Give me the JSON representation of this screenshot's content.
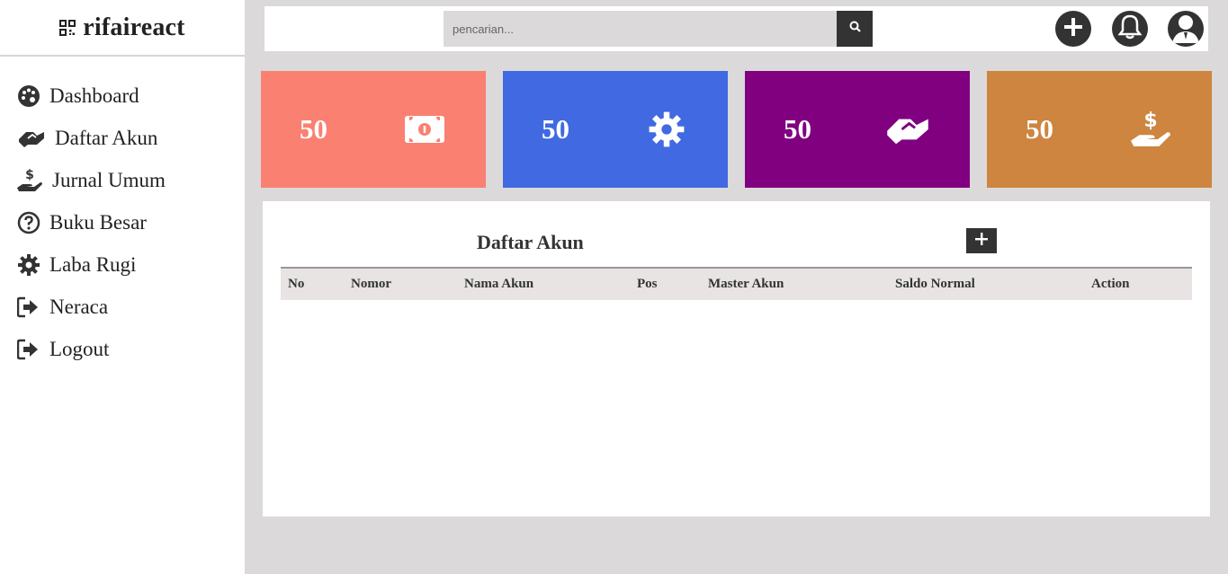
{
  "brand": {
    "name": "rifaireact",
    "icon": "qrcode-icon"
  },
  "sidebar": {
    "items": [
      {
        "label": "Dashboard",
        "icon": "palette-icon"
      },
      {
        "label": "Daftar Akun",
        "icon": "handshake-icon"
      },
      {
        "label": "Jurnal Umum",
        "icon": "hand-holding-dollar-icon"
      },
      {
        "label": "Buku Besar",
        "icon": "question-circle-icon"
      },
      {
        "label": "Laba Rugi",
        "icon": "gear-icon"
      },
      {
        "label": "Neraca",
        "icon": "sign-out-icon"
      },
      {
        "label": "Logout",
        "icon": "sign-out-icon"
      }
    ]
  },
  "topbar": {
    "search_placeholder": "pencarian...",
    "icons": [
      "search-icon",
      "plus-circle-icon",
      "bell-icon",
      "user-icon"
    ]
  },
  "cards": [
    {
      "value": "50",
      "icon": "money-bill-icon",
      "color": "#fa8072"
    },
    {
      "value": "50",
      "icon": "gear-icon",
      "color": "#4169e1"
    },
    {
      "value": "50",
      "icon": "handshake-icon",
      "color": "#800080"
    },
    {
      "value": "50",
      "icon": "hand-holding-dollar-icon",
      "color": "#cd853f"
    }
  ],
  "panel": {
    "title": "Daftar Akun",
    "columns": [
      "No",
      "Nomor",
      "Nama Akun",
      "Pos",
      "Master Akun",
      "Saldo Normal",
      "Action"
    ],
    "rows": []
  },
  "colors": {
    "dark": "#333333",
    "background": "#dbd9da",
    "table_header": "#e8e4e4"
  }
}
